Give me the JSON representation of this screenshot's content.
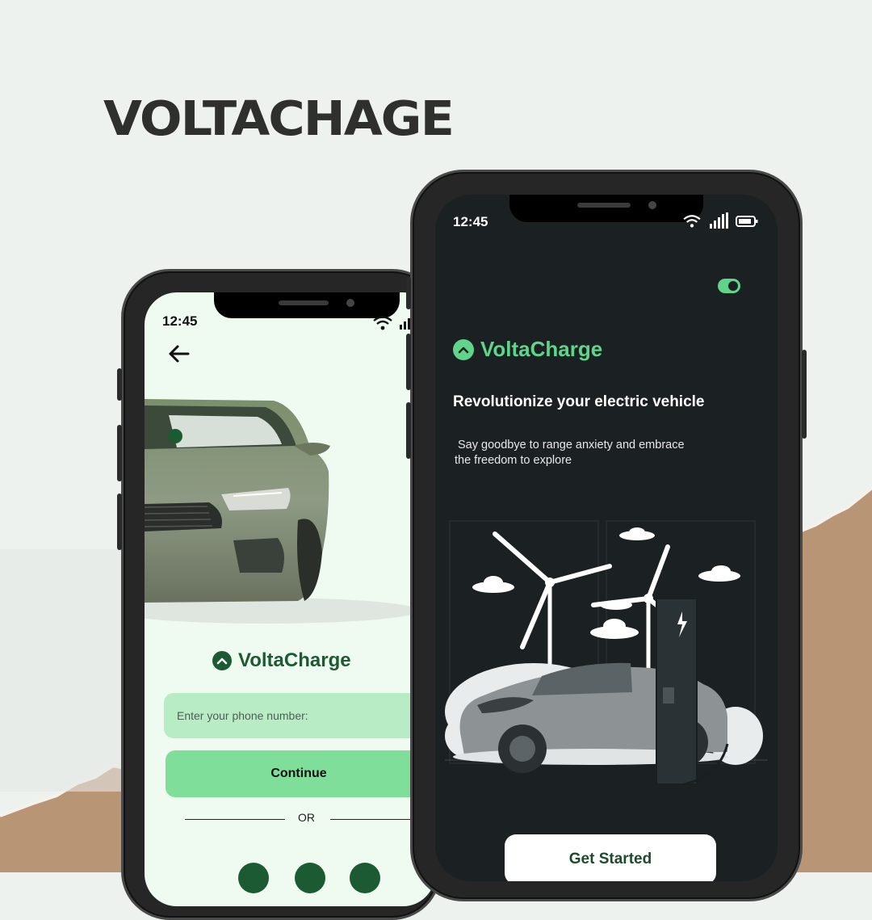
{
  "page": {
    "title": "VOLTACHAGE"
  },
  "left_phone": {
    "status_time": "12:45",
    "brand_name": "VoltaCharge",
    "phone_input_placeholder": "Enter your phone number:",
    "continue_label": "Continue",
    "or_label": "OR"
  },
  "right_phone": {
    "status_time": "12:45",
    "brand_name": "VoltaCharge",
    "headline": "Revolutionize your electric vehicle",
    "subtext_line1": "Say goodbye to range anxiety and embrace",
    "subtext_line2": "the freedom to explore",
    "get_started_label": "Get Started",
    "toggle_on": true
  },
  "colors": {
    "background": "#eef2ee",
    "brand_green": "#1c5a33",
    "accent_green": "#5fd48a",
    "dark_screen": "#1b2022",
    "button_green": "#7fde9a",
    "paper": "#b89575"
  },
  "icons": [
    "back-arrow-icon",
    "wifi-icon",
    "signal-icon",
    "battery-icon",
    "logo-chevron-icon",
    "lightning-icon",
    "facebook-icon",
    "google-icon",
    "apple-icon"
  ]
}
